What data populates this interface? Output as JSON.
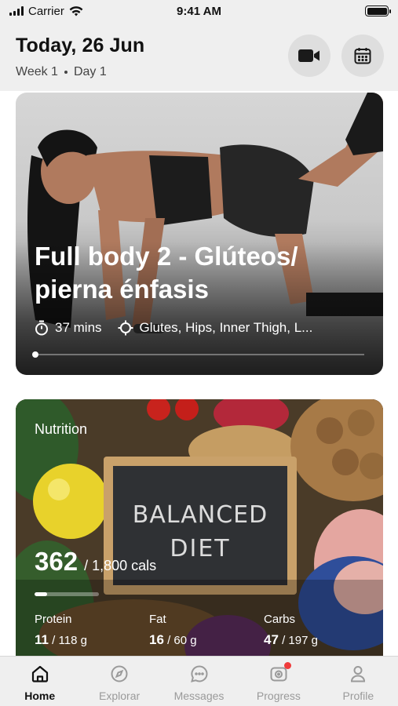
{
  "status_bar": {
    "carrier": "Carrier",
    "time": "9:41 AM"
  },
  "header": {
    "title": "Today, 26 Jun",
    "week": "Week 1",
    "day": "Day 1"
  },
  "workout": {
    "title": "Full body 2 - Glúteos/ pierna énfasis",
    "duration": "37 mins",
    "targets": "Glutes, Hips, Inner Thigh, L...",
    "progress": 0
  },
  "nutrition": {
    "label": "Nutrition",
    "calories": "362",
    "calories_total": "/ 1,800 cals",
    "calories_fraction": 0.2,
    "macros": [
      {
        "label": "Protein",
        "value": "11",
        "total": "/ 118 g"
      },
      {
        "label": "Fat",
        "value": "16",
        "total": "/ 60 g"
      },
      {
        "label": "Carbs",
        "value": "47",
        "total": "/ 197 g"
      }
    ]
  },
  "tabs": [
    {
      "label": "Home",
      "icon": "home-icon",
      "active": true
    },
    {
      "label": "Explorar",
      "icon": "compass-icon"
    },
    {
      "label": "Messages",
      "icon": "chat-icon"
    },
    {
      "label": "Progress",
      "icon": "camera-icon",
      "badge": true
    },
    {
      "label": "Profile",
      "icon": "user-icon"
    }
  ],
  "colors": {
    "badge": "#ef3b3b",
    "header_bg": "#efefef",
    "header_button_bg": "#dedede"
  }
}
